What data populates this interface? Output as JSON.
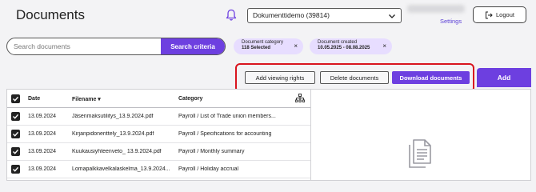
{
  "header": {
    "title": "Documents",
    "client_selector": "Dokumenttidemo (39814)",
    "settings_label": "Settings",
    "logout_label": "Logout"
  },
  "search": {
    "placeholder": "Search documents",
    "criteria_button": "Search criteria"
  },
  "filters": [
    {
      "label": "Document category",
      "value": "118 Selected",
      "close": "×"
    },
    {
      "label": "Document created",
      "value": "10.05.2025 - 08.08.2025",
      "close": "×"
    }
  ],
  "actions": {
    "add_viewing_rights": "Add viewing rights",
    "delete_documents": "Delete documents",
    "download_documents": "Download documents",
    "add": "Add"
  },
  "table": {
    "columns": {
      "date": "Date",
      "filename": "Filename ▾",
      "category": "Category"
    },
    "rows": [
      {
        "date": "13.09.2024",
        "filename": "Jäsenmaksutilitys_13.9.2024.pdf",
        "category": "Payroll / List of Trade union members..."
      },
      {
        "date": "13.09.2024",
        "filename": "Kirjanpidonerittely_13.9.2024.pdf",
        "category": "Payroll / Specifications for accounting"
      },
      {
        "date": "13.09.2024",
        "filename": "Kuukausiyhteenveto_ 13.9.2024.pdf",
        "category": "Payroll / Monthly summary"
      },
      {
        "date": "13.09.2024",
        "filename": "Lomapalkkavelkalaskelma_13.9.2024...",
        "category": "Payroll / Holiday accrual"
      }
    ]
  },
  "colors": {
    "accent": "#6d3fe0",
    "chip_bg": "#e7ddff",
    "highlight": "#d9141e"
  },
  "icons": {
    "notifications": "bell-icon",
    "dropdown": "chevron-down-icon",
    "logout": "logout-icon",
    "hierarchy": "hierarchy-icon",
    "preview": "documents-icon",
    "check": "checkmark-icon"
  }
}
